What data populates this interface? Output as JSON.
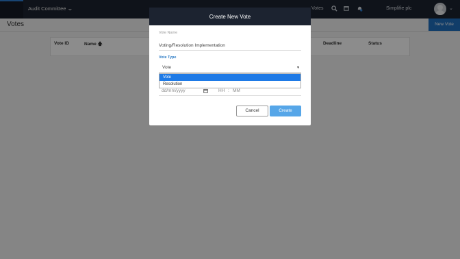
{
  "topbar": {
    "committee": "Audit Committee",
    "nav_votes": "Votes",
    "organization": "Simplifie plc"
  },
  "page": {
    "title": "Votes",
    "new_vote_label": "New Vote"
  },
  "table": {
    "headers": [
      "Vote ID",
      "Name",
      "Deadline",
      "Status"
    ]
  },
  "modal": {
    "title": "Create New Vote",
    "vote_name_label": "Vote Name",
    "vote_name_value": "Voting/Resolution Implementation",
    "vote_type_label": "Vote Type",
    "vote_type_selected": "Vote",
    "vote_type_options": [
      "Vote",
      "Resolution"
    ],
    "date_placeholder": "dd/mm/yyyy",
    "hour_placeholder": "HH",
    "time_separator": ":",
    "minute_placeholder": "MM",
    "cancel_label": "Cancel",
    "create_label": "Create"
  },
  "icons": {
    "search": "search-icon",
    "calendar": "calendar-icon",
    "notifications": "bell-icon"
  },
  "colors": {
    "topbar": "#1c2330",
    "accent": "#1f6fbf",
    "create_button": "#56a6e8",
    "selected_option": "#1e7ae6",
    "vote_type_label": "#2a7ac4"
  }
}
